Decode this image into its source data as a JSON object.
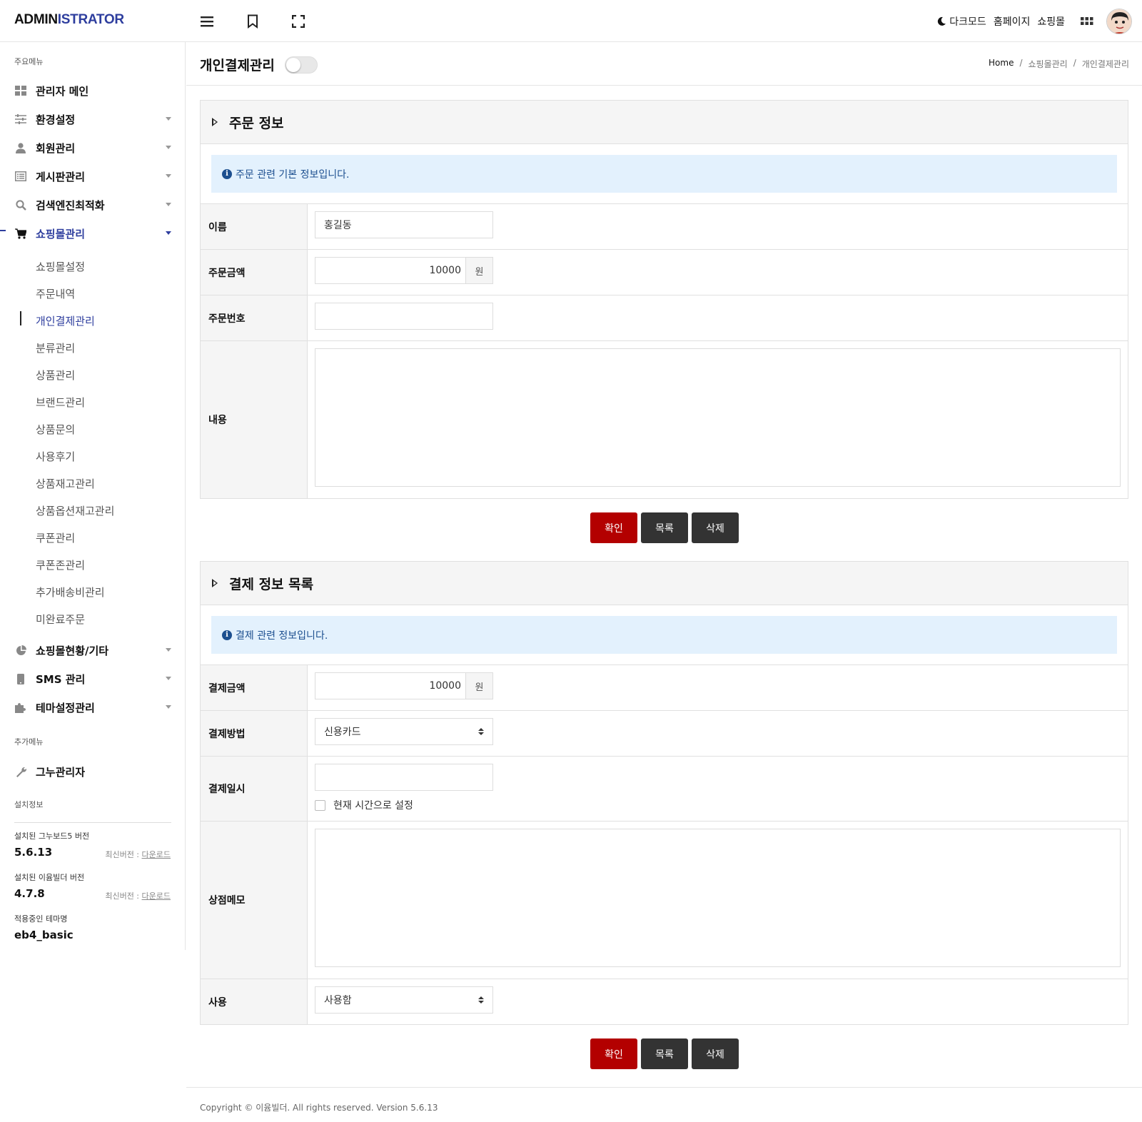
{
  "header": {
    "logo_a": "ADMIN",
    "logo_b": "ISTRATOR",
    "dark_mode": "다크모드",
    "homepage": "홈페이지",
    "shop": "쇼핑몰"
  },
  "sidebar": {
    "main_title": "주요메뉴",
    "items": [
      {
        "label": "관리자 메인"
      },
      {
        "label": "환경설정"
      },
      {
        "label": "회원관리"
      },
      {
        "label": "게시판관리"
      },
      {
        "label": "검색엔진최적화"
      },
      {
        "label": "쇼핑몰관리"
      }
    ],
    "sub_items": [
      {
        "label": "쇼핑몰설정"
      },
      {
        "label": "주문내역"
      },
      {
        "label": "개인결제관리"
      },
      {
        "label": "분류관리"
      },
      {
        "label": "상품관리"
      },
      {
        "label": "브랜드관리"
      },
      {
        "label": "상품문의"
      },
      {
        "label": "사용후기"
      },
      {
        "label": "상품재고관리"
      },
      {
        "label": "상품옵션재고관리"
      },
      {
        "label": "쿠폰관리"
      },
      {
        "label": "쿠폰존관리"
      },
      {
        "label": "추가배송비관리"
      },
      {
        "label": "미완료주문"
      }
    ],
    "items2": [
      {
        "label": "쇼핑몰현황/기타"
      },
      {
        "label": "SMS 관리"
      },
      {
        "label": "테마설정관리"
      }
    ],
    "extra_title": "추가메뉴",
    "extra_item": "그누관리자",
    "install_title": "설치정보",
    "gnu_label": "설치된 그누보드5 버전",
    "gnu_version": "5.6.13",
    "latest_label": "최신버전 : ",
    "download": "다운로드",
    "eyoom_label": "설치된 이윰빌더 버전",
    "eyoom_version": "4.7.8",
    "theme_label": "적용중인 테마명",
    "theme_name": "eb4_basic"
  },
  "page": {
    "title": "개인결제관리",
    "crumbs": [
      "Home",
      "/",
      "쇼핑몰관리",
      "/",
      "개인결제관리"
    ]
  },
  "order": {
    "title": "주문 정보",
    "notice": "주문 관련 기본 정보입니다.",
    "name_label": "이름",
    "name_value": "홍길동",
    "amount_label": "주문금액",
    "amount_value": "10000",
    "unit": "원",
    "number_label": "주문번호",
    "content_label": "내용"
  },
  "buttons": {
    "confirm": "확인",
    "list": "목록",
    "delete": "삭제"
  },
  "payment": {
    "title": "결제 정보 목록",
    "notice": "결제 관련 정보입니다.",
    "amount_label": "결제금액",
    "amount_value": "10000",
    "unit": "원",
    "method_label": "결제방법",
    "method_value": "신용카드",
    "date_label": "결제일시",
    "now_label": "현재 시간으로 설정",
    "memo_label": "상점메모",
    "use_label": "사용",
    "use_value": "사용함"
  },
  "footer": "Copyright © 이윰빌더. All rights reserved. Version 5.6.13",
  "colors": {
    "accent": "#2e3e9e",
    "danger": "#b30000",
    "notice_bg": "#e3f1fd"
  }
}
